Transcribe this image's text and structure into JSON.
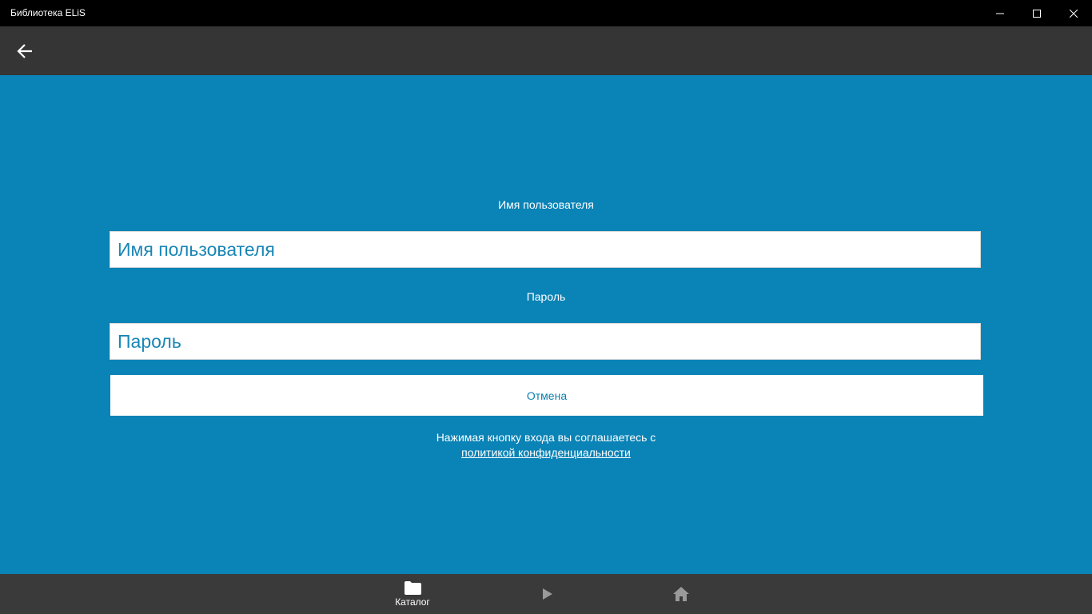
{
  "window": {
    "title": "Библиотека ELiS"
  },
  "icons": {
    "minimize": "minimize-icon",
    "maximize": "maximize-icon",
    "close": "close-icon",
    "back": "arrow-left-icon",
    "catalog": "folder-icon",
    "play": "play-icon",
    "home": "home-icon"
  },
  "form": {
    "username_label": "Имя пользователя",
    "username_placeholder": "Имя пользователя",
    "username_value": "",
    "password_label": "Пароль",
    "password_placeholder": "Пароль",
    "password_value": "",
    "cancel_label": "Отмена",
    "agreement_text": "Нажимая кнопку входа вы соглашаетесь с",
    "privacy_link": "политикой конфиденциальности"
  },
  "bottom_nav": {
    "catalog_label": "Каталог"
  },
  "colors": {
    "accent": "#0a83b6",
    "titlebar": "#000000",
    "navbar": "#353535",
    "bottombar": "#3a3a3a"
  }
}
